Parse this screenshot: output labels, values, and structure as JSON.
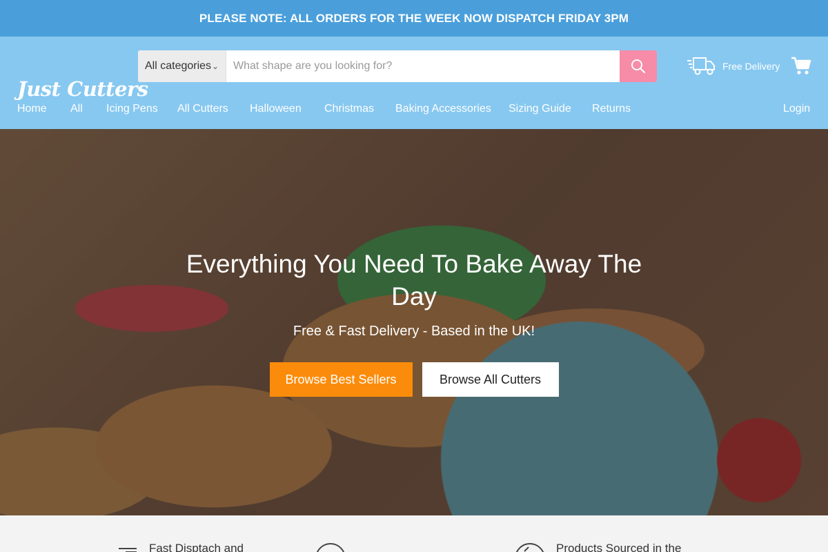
{
  "announcement": "PLEASE NOTE: ALL ORDERS FOR THE WEEK NOW DISPATCH FRIDAY 3PM",
  "header": {
    "logo": "Just Cutters",
    "search": {
      "category": "All categories",
      "placeholder": "What shape are you looking for?"
    },
    "delivery_label": "Free Delivery",
    "nav": [
      "Home",
      "All",
      "Icing Pens",
      "All Cutters",
      "Halloween",
      "Christmas",
      "Baking Accessories",
      "Sizing Guide",
      "Returns"
    ],
    "login": "Login"
  },
  "hero": {
    "title": "Everything You Need To Bake Away The Day",
    "subtitle": "Free & Fast Delivery - Based in the UK!",
    "primary_button": "Browse Best Sellers",
    "secondary_button": "Browse All Cutters"
  },
  "features": [
    {
      "icon": "box-icon",
      "label": "Fast Disptach and"
    },
    {
      "icon": "clock-icon",
      "label": ""
    },
    {
      "icon": "refresh-icon",
      "label": "Products Sourced in the"
    }
  ],
  "colors": {
    "announcement_bg": "#4a9fdb",
    "header_bg": "#87c8f0",
    "search_button": "#f68ca8",
    "primary_button": "#fb8c0b"
  }
}
